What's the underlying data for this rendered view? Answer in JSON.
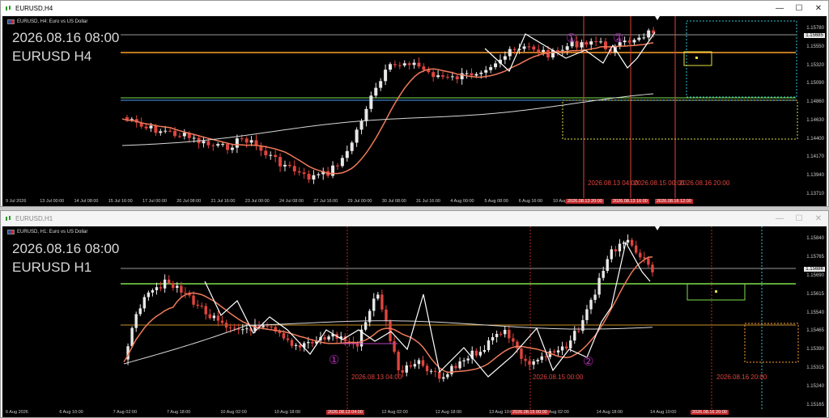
{
  "top": {
    "window_title": "EURUSD,H4",
    "header": "EURUSD, H4:  Euro vs US Dollar",
    "overlay_date": "2026.08.16 08:00",
    "overlay_symbol": "EURUSD H4",
    "current_price": "1.15685",
    "y_ticks": [
      "1.15780",
      "1.15550",
      "1.15320",
      "1.15090",
      "1.14860",
      "1.14630",
      "1.14400",
      "1.14170",
      "1.13940",
      "1.13710"
    ],
    "x_ticks": [
      "9 Jul 2026",
      "13 Jul 00:00",
      "14 Jul 08:00",
      "15 Jul 16:00",
      "17 Jul 00:00",
      "20 Jul 08:00",
      "21 Jul 16:00",
      "23 Jul 00:00",
      "24 Jul 08:00",
      "27 Jul 16:00",
      "29 Jul 00:00",
      "30 Jul 08:00",
      "31 Jul 16:00",
      "4 Aug 00:00",
      "5 Aug 08:00",
      "6 Aug 16:00",
      "10 Aug 00:00"
    ],
    "x_boxes": [
      "2026.08.13 20:00",
      "2026.08.13 16:00",
      "2026.08.16 12:00"
    ],
    "vline_labels": [
      "2026.08.13 04:00",
      "2026.08.15 00:00",
      "2026.08.16 20:00"
    ],
    "markers": [
      "①",
      "②"
    ]
  },
  "bottom": {
    "window_title": "EURUSD,H1",
    "header": "EURUSD, H1:  Euro vs US Dollar",
    "overlay_date": "2026.08.16 08:00",
    "overlay_symbol": "EURUSD H1",
    "current_price": "1.15686",
    "y_ticks": [
      "1.15840",
      "1.15765",
      "1.15690",
      "1.15615",
      "1.15540",
      "1.15465",
      "1.15390",
      "1.15315",
      "1.15240",
      "1.15165"
    ],
    "x_ticks": [
      "6 Aug 2026",
      "6 Aug 10:00",
      "7 Aug 02:00",
      "7 Aug 18:00",
      "10 Aug 02:00",
      "10 Aug 18:00",
      "11 Aug 10:00",
      "12 Aug 02:00",
      "12 Aug 18:00",
      "13 Aug 10:00",
      "14 Aug 02:00",
      "14 Aug 18:00",
      "14 Aug 10:00"
    ],
    "x_boxes": [
      "2026.08.13 04:00",
      "2026.08.15 00:00",
      "2026.08.16 20:00"
    ],
    "vline_labels": [
      "2026.08.13 04:00",
      "2026.08.15 00:00",
      "2026.08.16 20:00"
    ],
    "markers": [
      "①",
      "②"
    ]
  },
  "window_controls": {
    "minimize": "—",
    "maximize": "☐",
    "close": "✕"
  },
  "colors": {
    "bull": "#e8e8e8",
    "bear": "#e0443e",
    "orange_line": "#ff9f2a",
    "green_line": "#7ee04a",
    "cyan": "#2fc4d4",
    "yellow": "#e0e040"
  }
}
